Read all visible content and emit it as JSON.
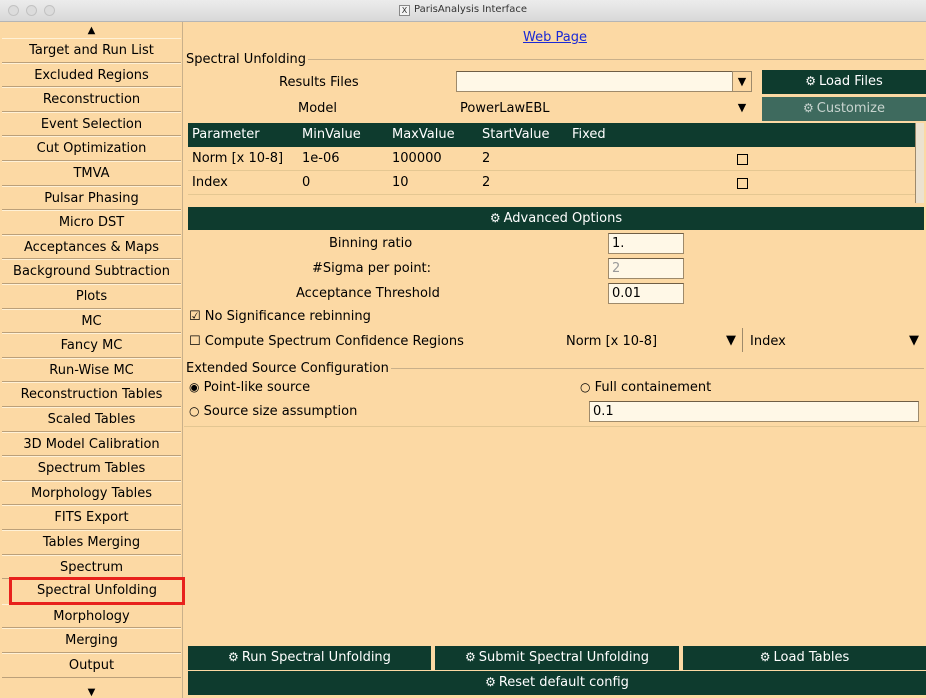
{
  "window": {
    "title": "ParisAnalysis Interface"
  },
  "sidebar": {
    "items": [
      "Target and Run List",
      "Excluded Regions",
      "Reconstruction",
      "Event Selection",
      "Cut Optimization",
      "TMVA",
      "Pulsar Phasing",
      "Micro DST",
      "Acceptances & Maps",
      "Background Subtraction",
      "Plots",
      "MC",
      "Fancy MC",
      "Run-Wise MC",
      "Reconstruction Tables",
      "Scaled Tables",
      "3D Model Calibration",
      "Spectrum Tables",
      "Morphology Tables",
      "FITS Export",
      "Tables Merging",
      "Spectrum",
      "Spectral Unfolding",
      "Morphology",
      "Merging",
      "Output"
    ],
    "selected": "Spectral Unfolding"
  },
  "main": {
    "web_link": "Web Page",
    "group_title": "Spectral Unfolding",
    "results_files_label": "Results Files",
    "results_files_value": "",
    "load_files_button": "Load Files",
    "model_label": "Model",
    "model_value": "PowerLawEBL",
    "customize_button": "Customize",
    "table": {
      "headers": [
        "Parameter",
        "MinValue",
        "MaxValue",
        "StartValue",
        "Fixed"
      ],
      "rows": [
        {
          "parameter": "Norm [x 10-8]",
          "min": "1e-06",
          "max": "100000",
          "start": "2",
          "fixed": false
        },
        {
          "parameter": "Index",
          "min": "0",
          "max": "10",
          "start": "2",
          "fixed": false
        }
      ]
    },
    "advanced_options": "Advanced Options",
    "binning_ratio_label": "Binning ratio",
    "binning_ratio_value": "1.",
    "sigma_label": "#Sigma per point:",
    "sigma_value": "2",
    "acceptance_label": "Acceptance Threshold",
    "acceptance_value": "0.01",
    "no_significance_label": "No Significance rebinning",
    "no_significance_checked": true,
    "confidence_label": "Compute Spectrum Confidence Regions",
    "confidence_checked": false,
    "confidence_param1": "Norm [x 10-8]",
    "confidence_param2": "Index",
    "extended_title": "Extended Source Configuration",
    "point_like_label": "Point-like source",
    "full_containment_label": "Full containement",
    "source_size_label": "Source size assumption",
    "source_size_value": "0.1",
    "run_button": "Run Spectral Unfolding",
    "submit_button": "Submit Spectral Unfolding",
    "load_tables_button": "Load Tables",
    "reset_button": "Reset default config"
  }
}
